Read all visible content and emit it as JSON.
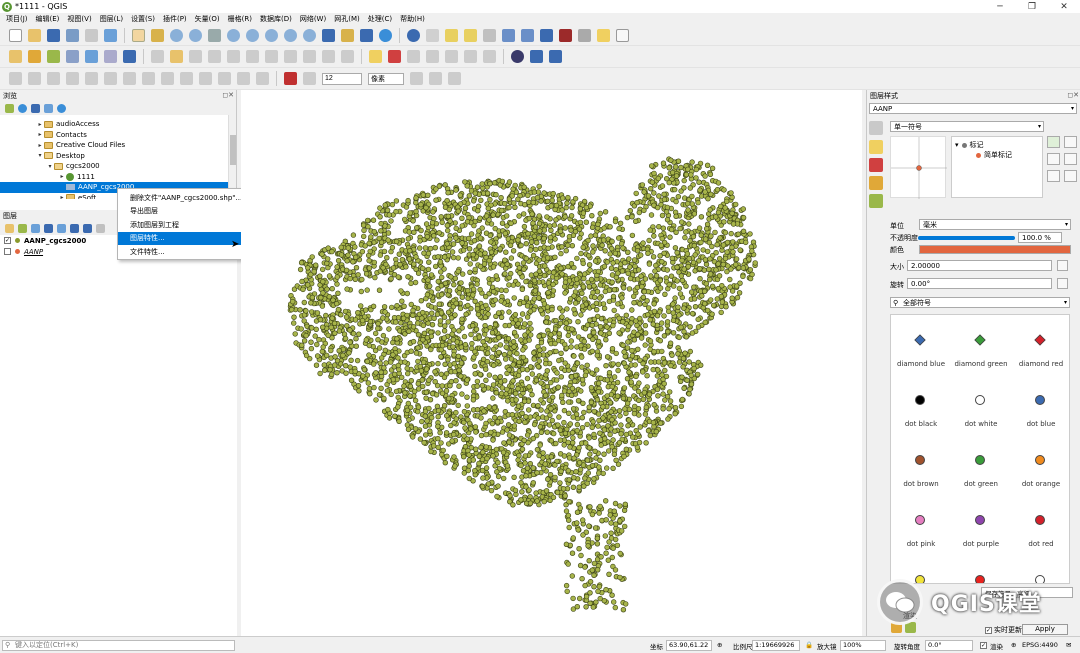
{
  "window": {
    "title": "*1111 - QGIS",
    "app_logo_letter": "Q"
  },
  "menu": [
    "项目(J)",
    "编辑(E)",
    "视图(V)",
    "图层(L)",
    "设置(S)",
    "插件(P)",
    "矢量(O)",
    "栅格(R)",
    "数据库(D)",
    "网络(W)",
    "网孔(M)",
    "处理(C)",
    "帮助(H)"
  ],
  "toolbar": {
    "scale_input": "12",
    "units_label": "像素"
  },
  "browser": {
    "title": "浏览",
    "items": [
      {
        "label": "audioAccess",
        "icon": "folder-icon"
      },
      {
        "label": "Contacts",
        "icon": "folder-icon"
      },
      {
        "label": "Creative Cloud Files",
        "icon": "folder-icon"
      },
      {
        "label": "Desktop",
        "icon": "folder-icon"
      },
      {
        "label": "cgcs2000",
        "icon": "folder-icon"
      },
      {
        "label": "1111",
        "icon": "qgis-project-icon"
      },
      {
        "label": "AANP_cgcs2000",
        "icon": "shapefile-icon"
      },
      {
        "label": "eSoft",
        "icon": "folder-icon"
      }
    ]
  },
  "layers": {
    "title": "图层",
    "items": [
      {
        "label": "AANP_cgcs2000",
        "checked": true,
        "color": "#8a9a2c"
      },
      {
        "label": "AANP",
        "checked": false,
        "color": "#e2663f"
      }
    ]
  },
  "context_menu": {
    "items": [
      "删除文件\"AANP_cgcs2000.shp\"...",
      "导出图层",
      "添加图层到工程",
      "图层特性...",
      "文件特性..."
    ],
    "highlighted_index": 3
  },
  "map": {
    "point_fill": "#a7b44a",
    "point_stroke": "#3a4115"
  },
  "style_panel": {
    "title": "图层样式",
    "layer_combo": "AANP",
    "renderer": "单一符号",
    "symbol_tree": [
      "标记",
      "简单标记"
    ],
    "unit_label": "单位",
    "unit_value": "毫米",
    "opacity_label": "不透明度",
    "opacity_value": "100.0 %",
    "color_label": "颜色",
    "size_label": "大小",
    "size_value": "2.00000",
    "rotation_label": "旋转",
    "rotation_value": "0.00°",
    "search_placeholder": "全部符号",
    "symbols": [
      {
        "label": "diamond blue",
        "color": "#3b6ab0",
        "shape": "diamond"
      },
      {
        "label": "diamond green",
        "color": "#3a9c3a",
        "shape": "diamond"
      },
      {
        "label": "diamond red",
        "color": "#d4202a",
        "shape": "diamond"
      },
      {
        "label": "dot  black",
        "color": "#000000",
        "shape": "dot"
      },
      {
        "label": "dot  white",
        "color": "#ffffff",
        "shape": "dot"
      },
      {
        "label": "dot blue",
        "color": "#3b6ab0",
        "shape": "dot"
      },
      {
        "label": "dot brown",
        "color": "#a0522d",
        "shape": "dot"
      },
      {
        "label": "dot green",
        "color": "#3a9c3a",
        "shape": "dot"
      },
      {
        "label": "dot orange",
        "color": "#f08a1e",
        "shape": "dot"
      },
      {
        "label": "dot pink",
        "color": "#e57ec0",
        "shape": "dot"
      },
      {
        "label": "dot purple",
        "color": "#8e44ad",
        "shape": "dot"
      },
      {
        "label": "dot red",
        "color": "#d4202a",
        "shape": "dot"
      }
    ],
    "save_symbol": "保存符号",
    "advanced": "高级",
    "render_label": "渲染",
    "live_update": "实时更新",
    "apply": "Apply"
  },
  "status": {
    "search_placeholder": "键入以定位(Ctrl+K)",
    "coord_label": "坐标",
    "coord_value": "63.90,61.22",
    "scale_label": "比例尺",
    "scale_value": "1:19669926",
    "magnifier_label": "放大镜",
    "magnifier_value": "100%",
    "rotation_label": "旋转角度",
    "rotation_value": "0.0°",
    "render_label": "渲染",
    "crs": "EPSG:4490"
  },
  "watermark": {
    "text": "QGIS课堂"
  }
}
